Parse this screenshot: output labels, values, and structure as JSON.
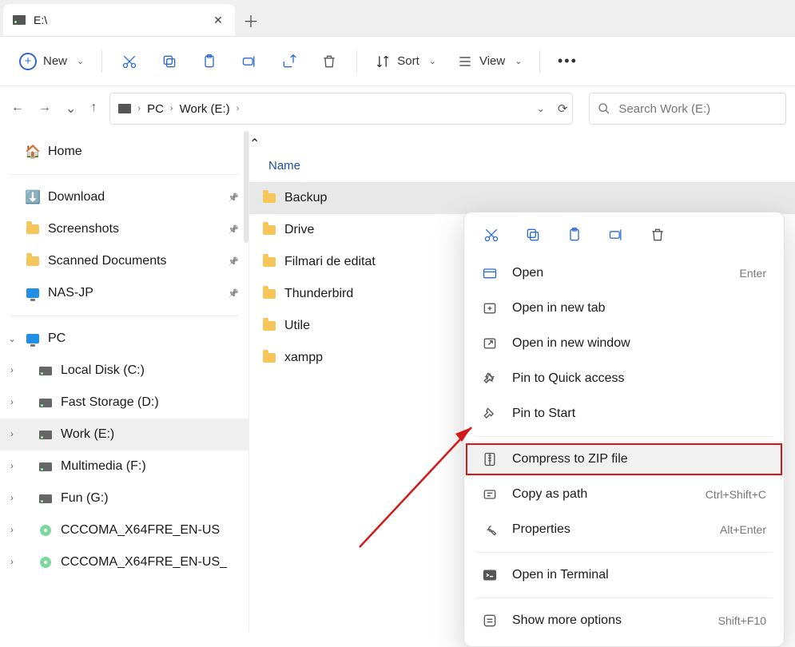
{
  "tab": {
    "title": "E:\\"
  },
  "toolbar": {
    "new_label": "New",
    "sort_label": "Sort",
    "view_label": "View"
  },
  "breadcrumb": {
    "segments": [
      "PC",
      "Work (E:)"
    ]
  },
  "search": {
    "placeholder": "Search Work (E:)"
  },
  "sidebar": {
    "home": "Home",
    "quick": [
      {
        "label": "Download"
      },
      {
        "label": "Screenshots"
      },
      {
        "label": "Scanned Documents"
      },
      {
        "label": "NAS-JP"
      }
    ],
    "pc_label": "PC",
    "drives": [
      {
        "label": "Local Disk (C:)"
      },
      {
        "label": "Fast Storage (D:)"
      },
      {
        "label": "Work (E:)",
        "selected": true
      },
      {
        "label": "Multimedia (F:)"
      },
      {
        "label": "Fun (G:)"
      },
      {
        "label": "CCCOMA_X64FRE_EN-US"
      },
      {
        "label": "CCCOMA_X64FRE_EN-US_"
      }
    ]
  },
  "columns": {
    "name": "Name"
  },
  "files": [
    {
      "name": "Backup",
      "selected": true
    },
    {
      "name": "Drive"
    },
    {
      "name": "Filmari de editat"
    },
    {
      "name": "Thunderbird"
    },
    {
      "name": "Utile"
    },
    {
      "name": "xampp"
    }
  ],
  "context_menu": {
    "open": "Open",
    "open_shortcut": "Enter",
    "open_new_tab": "Open in new tab",
    "open_new_window": "Open in new window",
    "pin_quick": "Pin to Quick access",
    "pin_start": "Pin to Start",
    "compress": "Compress to ZIP file",
    "copy_path": "Copy as path",
    "copy_path_shortcut": "Ctrl+Shift+C",
    "properties": "Properties",
    "properties_shortcut": "Alt+Enter",
    "terminal": "Open in Terminal",
    "more": "Show more options",
    "more_shortcut": "Shift+F10"
  }
}
